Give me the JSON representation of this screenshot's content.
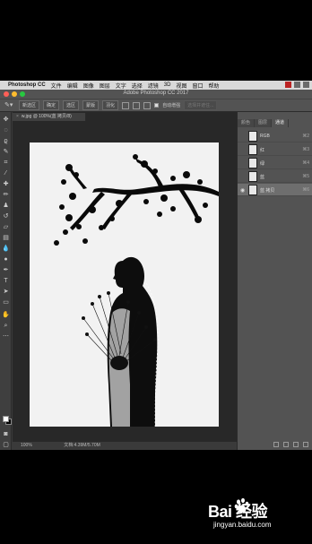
{
  "menubar": {
    "app_name": "Photoshop CC",
    "items": [
      "文件",
      "编辑",
      "图像",
      "图层",
      "文字",
      "选择",
      "滤镜",
      "3D",
      "视图",
      "窗口",
      "帮助"
    ]
  },
  "titlebar": {
    "title": "Adobe Photoshop CC 2017"
  },
  "options_bar": {
    "feather_label": "新选区",
    "buttons": [
      "确定",
      "选区",
      "蒙版",
      "羽化"
    ],
    "checkbox_label": "自动增强",
    "right_button": "选择并遮住..."
  },
  "document": {
    "tab_label": "w.jpg @ 100%(蓝 拷贝/8)",
    "status_zoom": "100%",
    "status_size": "文档:4.39M/5.70M"
  },
  "panel": {
    "tabs": [
      "颜色",
      "图层",
      "通道"
    ],
    "active_tab": "通道",
    "channels": [
      {
        "name": "RGB",
        "shortcut": "⌘2"
      },
      {
        "name": "红",
        "shortcut": "⌘3"
      },
      {
        "name": "绿",
        "shortcut": "⌘4"
      },
      {
        "name": "蓝",
        "shortcut": "⌘5"
      },
      {
        "name": "蓝 拷贝",
        "shortcut": "⌘6"
      }
    ]
  },
  "watermark": {
    "logo": "Bai  经验",
    "url": "jingyan.baidu.com"
  },
  "colors": {
    "canvas_bg": "#f1f1f1",
    "app_bg": "#3a3a3a",
    "panel_bg": "#535353"
  }
}
